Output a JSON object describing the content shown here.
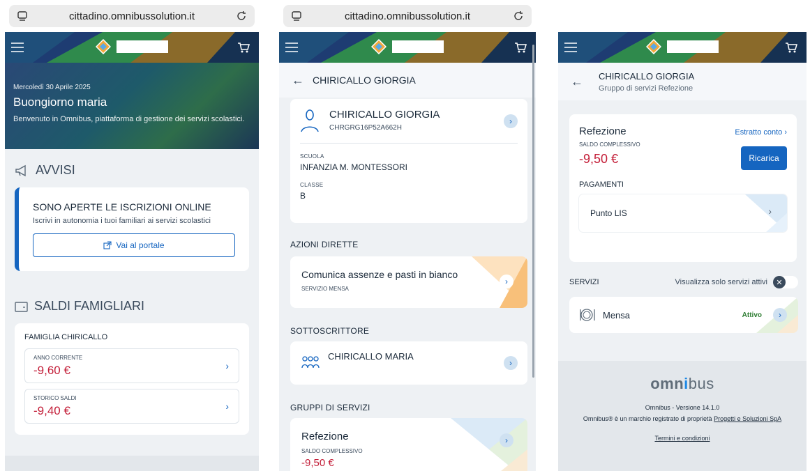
{
  "browser": {
    "url": "cittadino.omnibussolution.it"
  },
  "colors": {
    "accent": "#1565c0",
    "negative": "#c4203a",
    "active": "#2e7d32"
  },
  "panel1": {
    "date": "Mercoledì 30 Aprile 2025",
    "greeting": "Buongiorno maria",
    "welcome": "Benvenuto in Omnibus, piattaforma di gestione dei servizi scolastici.",
    "avvisi_title": "AVVISI",
    "notice": {
      "title": "SONO APERTE LE ISCRIZIONI ONLINE",
      "text": "Iscrivi in autonomia i tuoi familiari ai servizi scolastici",
      "button": "Vai al portale"
    },
    "saldi_title": "SALDI FAMIGLIARI",
    "family": {
      "name": "FAMIGLIA CHIRICALLO",
      "rows": [
        {
          "label": "ANNO CORRENTE",
          "value": "-9,60 €"
        },
        {
          "label": "STORICO SALDI",
          "value": "-9,40 €"
        }
      ]
    }
  },
  "panel2": {
    "back_title": "CHIRICALLO GIORGIA",
    "student": {
      "name": "CHIRICALLO GIORGIA",
      "code": "CHRGRG16P52A662H",
      "school_label": "SCUOLA",
      "school": "INFANZIA M. MONTESSORI",
      "class_label": "CLASSE",
      "class": "B"
    },
    "azioni_title": "AZIONI DIRETTE",
    "azione": {
      "title": "Comunica assenze e pasti in bianco",
      "sub": "SERVIZIO MENSA"
    },
    "sottoscrittore_title": "SOTTOSCRITTORE",
    "sottoscrittore": {
      "name": "CHIRICALLO MARIA"
    },
    "gruppi_title": "GRUPPI DI SERVIZI",
    "gruppo": {
      "title": "Refezione",
      "label": "SALDO COMPLESSIVO",
      "value": "-9,50 €"
    }
  },
  "panel3": {
    "title": "CHIRICALLO GIORGIA",
    "subtitle": "Gruppo di servizi Refezione",
    "refezione": {
      "title": "Refezione",
      "estratto": "Estratto conto ›",
      "saldo_label": "SALDO COMPLESSIVO",
      "saldo": "-9,50 €",
      "ricarica": "Ricarica",
      "pagamenti_label": "PAGAMENTI",
      "punto": "Punto LIS"
    },
    "servizi_label": "SERVIZI",
    "toggle_label": "Visualizza solo servizi attivi",
    "servizio": {
      "name": "Mensa",
      "status": "Attivo"
    },
    "footer": {
      "logo_a": "omn",
      "logo_b": "i",
      "logo_c": "bus",
      "version": "Omnibus - Versione 14.1.0",
      "trademark": "Omnibus® è un marchio registrato di proprietà",
      "owner": "Progetti e Soluzioni SpA",
      "terms": "Termini e condizioni"
    }
  }
}
